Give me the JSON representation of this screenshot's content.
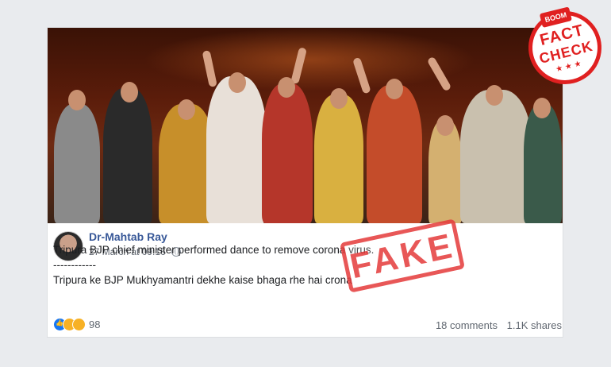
{
  "badge": {
    "brand": "BOOM",
    "line1": "FACT",
    "line2": "CHECK",
    "stars": "★★★"
  },
  "post": {
    "author": "Dr-Mahtab Ray",
    "timestamp": "27 March at 09:16",
    "text_line1": "Tripura BJP chief minister performed dance to remove corona virus.",
    "separator": "------------",
    "text_line2": "Tripura ke BJP Mukhyamantri dekhe kaise bhaga rhe hai crona",
    "reactions_count": "98",
    "comments": "18 comments",
    "shares": "1.1K shares"
  },
  "stamp": {
    "label": "FAKE"
  },
  "colors": {
    "brand_red": "#e02020",
    "link_blue": "#385898",
    "fb_bg": "#e9ebee"
  }
}
